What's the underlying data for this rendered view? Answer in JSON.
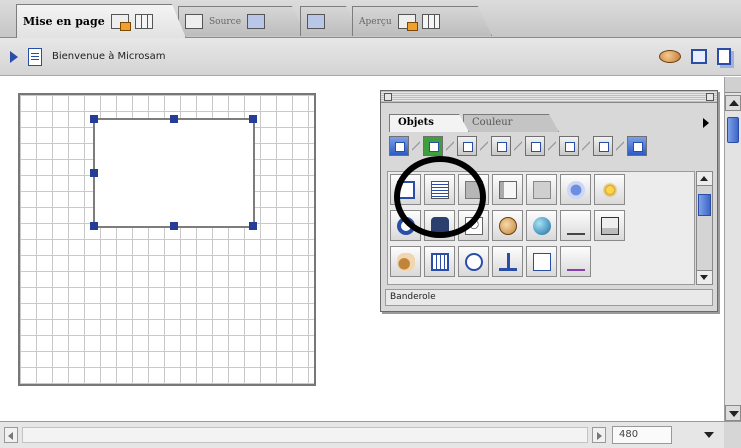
{
  "tabs": [
    {
      "label": "Mise en page",
      "active": true
    },
    {
      "label": "Source",
      "active": false
    },
    {
      "label": "Aperçu",
      "active": false
    }
  ],
  "toolbar": {
    "breadcrumb": "Bienvenue à Microsam"
  },
  "palette": {
    "tabs": [
      {
        "label": "Objets",
        "active": true
      },
      {
        "label": "Couleur",
        "active": false
      }
    ],
    "status_text": "Banderole"
  },
  "bottom": {
    "zoom": "480"
  },
  "colors": {
    "accent": "#2a4ea8",
    "handle": "#263d97",
    "annotation": "#000000"
  }
}
